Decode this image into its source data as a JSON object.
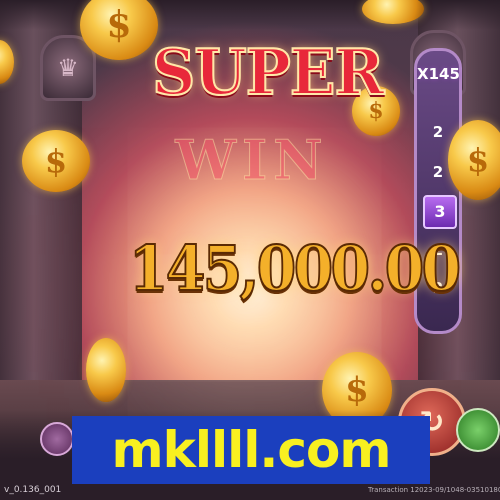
{
  "game": {
    "headline_top": "SUPER",
    "headline_bottom": "WIN",
    "win_amount": "145,000.00"
  },
  "multiplier": {
    "total": "X145",
    "values": [
      "2",
      "2",
      "3",
      "2",
      "2"
    ],
    "active_value": "3"
  },
  "coins": {
    "symbol": "$"
  },
  "banner": {
    "text": "mkllll.com",
    "background": "#1b3fbe",
    "color": "#f8f020"
  },
  "footer": {
    "version": "v_0.136_001",
    "transaction": "Transaction 12023-09/1048-03510180"
  },
  "colors": {
    "headline": "#e8283a",
    "amount": "#f4b02a",
    "multiplier_panel": "#6a4a86"
  },
  "icons": {
    "spin": "spin-arrow-icon",
    "menu": "menu-icon",
    "turbo": "turbo-icon"
  }
}
